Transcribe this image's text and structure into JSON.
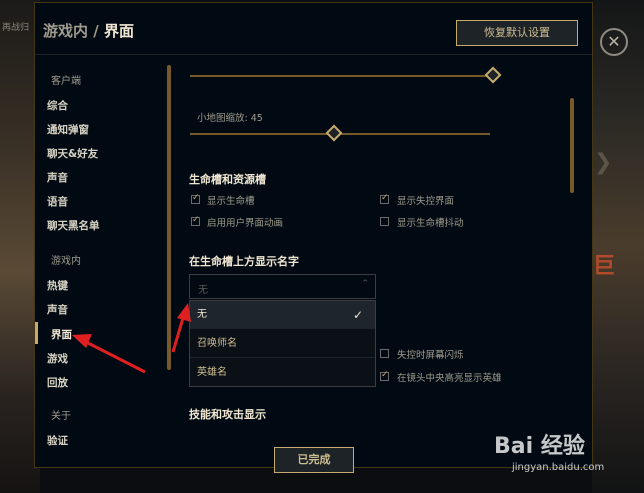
{
  "background": {
    "left_text": "再战归",
    "close_glyph": "✕",
    "right_text": "巨"
  },
  "dialog": {
    "title_section": "游戏内",
    "title_sep": "/",
    "title_page": "界面",
    "reset_button": "恢复默认设置",
    "done_button": "已完成"
  },
  "sidebar": {
    "client_label": "客户端",
    "client_items": [
      "综合",
      "通知弹窗",
      "聊天&好友",
      "声音",
      "语音",
      "聊天黑名单"
    ],
    "ingame_label": "游戏内",
    "ingame_items": [
      "热键",
      "声音",
      "界面",
      "游戏",
      "回放"
    ],
    "about_label": "关于",
    "about_items": [
      "验证"
    ]
  },
  "content": {
    "minimap_label": "小地图缩放: 45",
    "minimap_scale_value": 45,
    "health_section": "生命槽和资源槽",
    "checkboxes": [
      {
        "label": "显示生命槽",
        "checked": true
      },
      {
        "label": "显示失控界面",
        "checked": true
      },
      {
        "label": "启用用户界面动画",
        "checked": true
      },
      {
        "label": "显示生命槽抖动",
        "checked": false
      }
    ],
    "names_section": "在生命槽上方显示名字",
    "select_value": "无",
    "dropdown_options": [
      "无",
      "召唤师名",
      "英雄名"
    ],
    "dropdown_selected": "无",
    "lower_checkboxes": [
      {
        "label": "失控时屏幕闪烁",
        "checked": false
      },
      {
        "label": "在镜头中央高亮显示英雄",
        "checked": true
      }
    ],
    "skills_section": "技能和攻击显示"
  },
  "watermark": {
    "brand": "Bai 经验",
    "url": "jingyan.baidu.com"
  },
  "colors": {
    "gold": "#c8aa6e",
    "bg": "#010a13",
    "annotation_red": "#e02020"
  }
}
